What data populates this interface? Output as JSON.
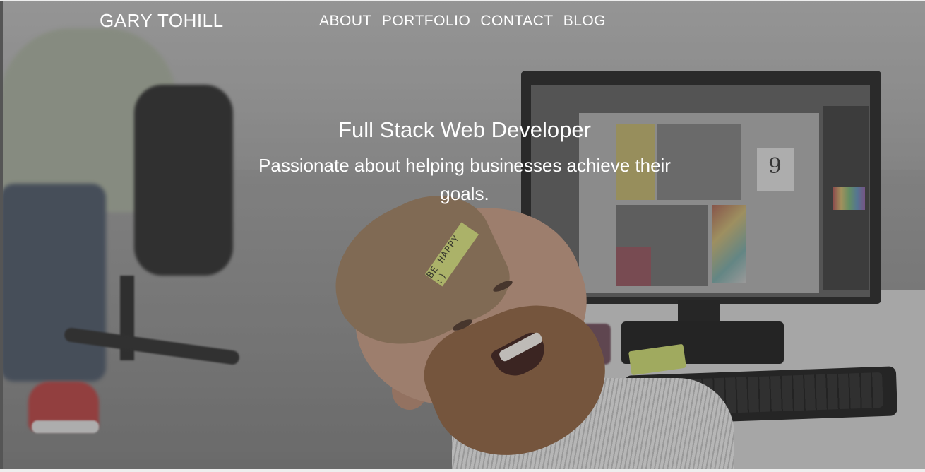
{
  "header": {
    "brand": "GARY TOHILL",
    "nav": [
      {
        "label": "ABOUT"
      },
      {
        "label": "PORTFOLIO"
      },
      {
        "label": "CONTACT"
      },
      {
        "label": "BLOG"
      }
    ]
  },
  "hero": {
    "title": "Full Stack Web Developer",
    "subtitle": "Passionate about helping businesses achieve their goals.",
    "sticky_note_text": "BE HAPPY :)",
    "screen_number": "9"
  },
  "colors": {
    "text": "#ffffff",
    "overlay": "#3c3c3c",
    "sticky_note": "#d6e07a"
  }
}
